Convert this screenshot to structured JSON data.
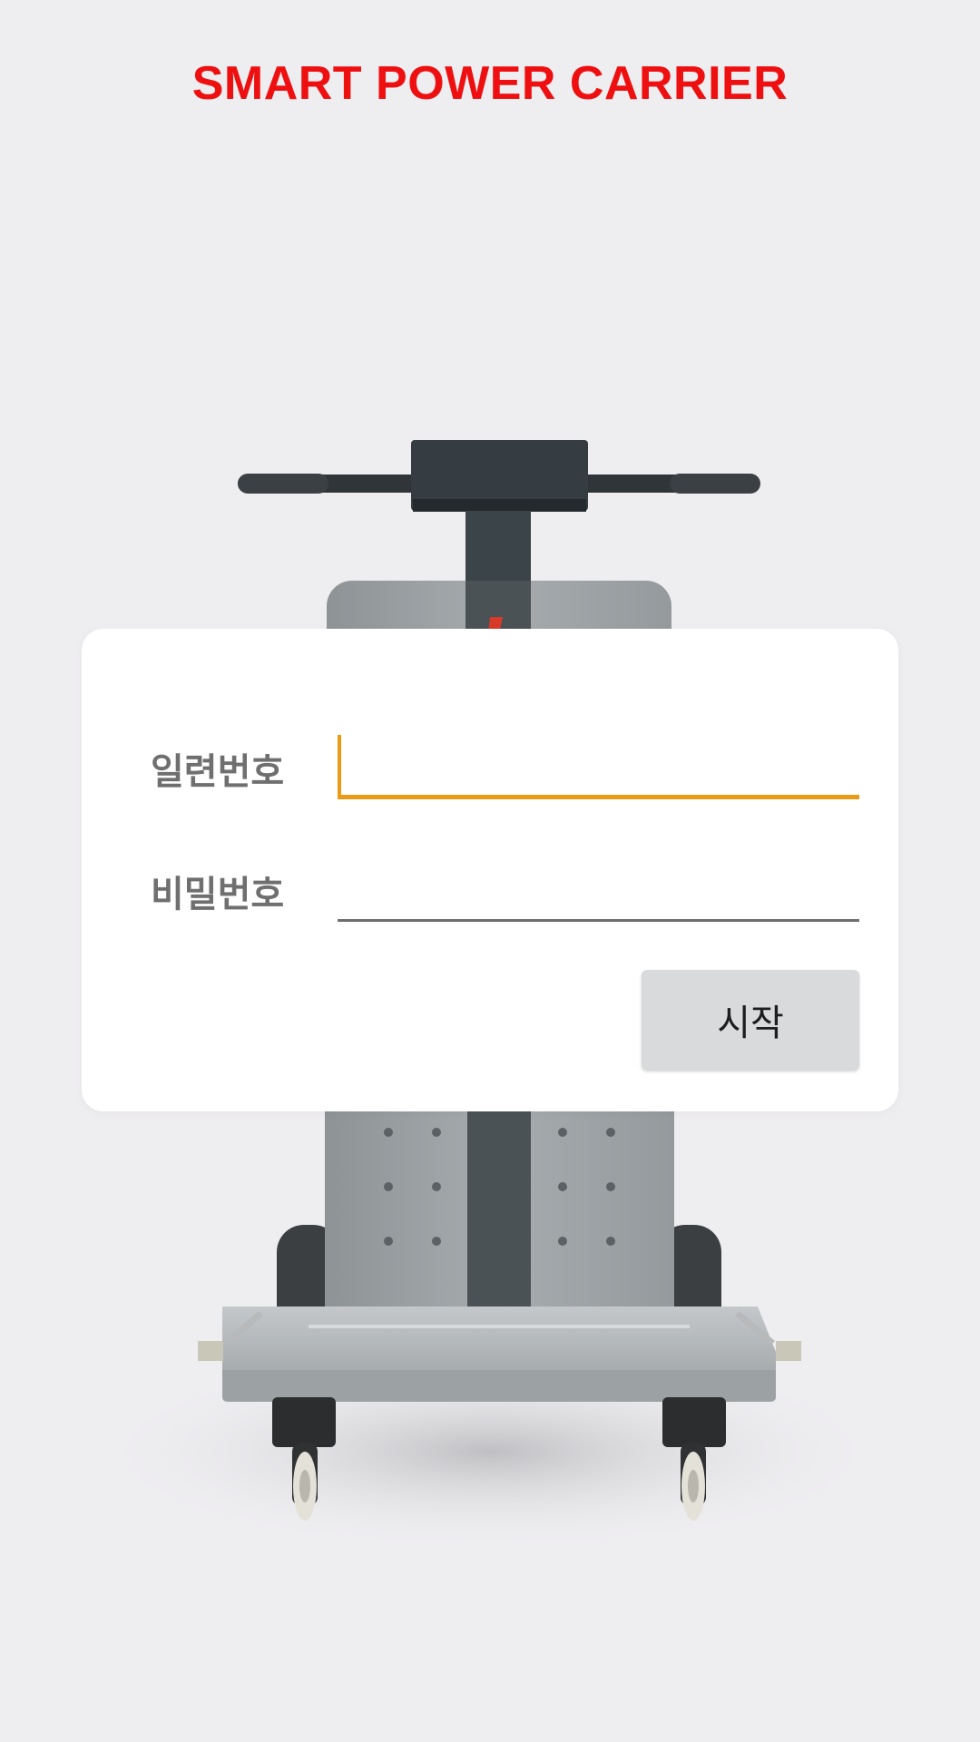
{
  "app": {
    "title": "SMART POWER CARRIER",
    "title_color": "#ee1010"
  },
  "background_image": {
    "icon": "power-carrier-cart-illustration"
  },
  "login": {
    "serial_label": "일련번호",
    "serial_value": "",
    "password_label": "비밀번호",
    "password_value": "",
    "start_label": "시작",
    "focus_color": "#e99b16"
  }
}
